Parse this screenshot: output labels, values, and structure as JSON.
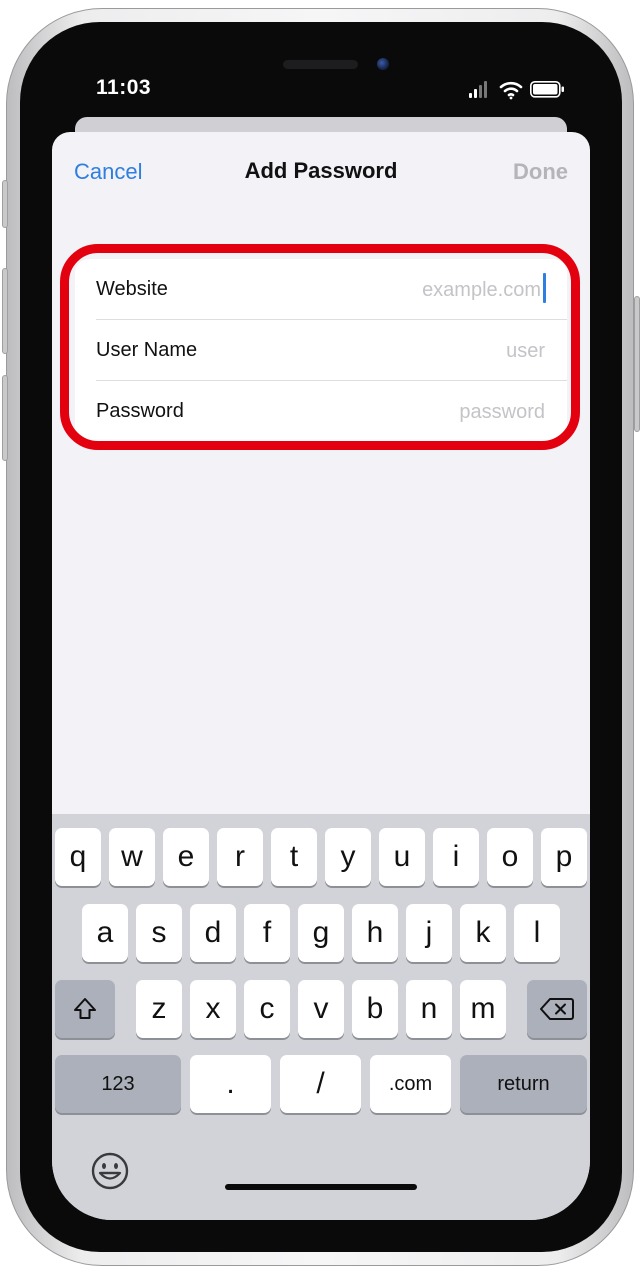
{
  "status_bar": {
    "time": "11:03",
    "icons": [
      "cellular-signal-icon",
      "wifi-icon",
      "battery-icon"
    ]
  },
  "nav": {
    "cancel": "Cancel",
    "title": "Add Password",
    "done": "Done"
  },
  "form": {
    "rows": [
      {
        "label": "Website",
        "placeholder": "example.com",
        "focused": true
      },
      {
        "label": "User Name",
        "placeholder": "user",
        "focused": false
      },
      {
        "label": "Password",
        "placeholder": "password",
        "focused": false
      }
    ]
  },
  "keyboard": {
    "row1": [
      "q",
      "w",
      "e",
      "r",
      "t",
      "y",
      "u",
      "i",
      "o",
      "p"
    ],
    "row2": [
      "a",
      "s",
      "d",
      "f",
      "g",
      "h",
      "j",
      "k",
      "l"
    ],
    "row3": [
      "z",
      "x",
      "c",
      "v",
      "b",
      "n",
      "m"
    ],
    "bottom": {
      "numbers": "123",
      "period": ".",
      "slash": "/",
      "dotcom": ".com",
      "return": "return"
    },
    "icons": {
      "shift": "shift-icon",
      "delete": "delete-icon",
      "emoji": "emoji-icon"
    }
  },
  "colors": {
    "accent": "#2f7fe0",
    "highlight": "#e3000f",
    "disabled": "#b4b4b9",
    "placeholder": "#c4c4c8",
    "screen_bg": "#f2f2f7",
    "keyboard_bg": "#d1d3d9"
  }
}
